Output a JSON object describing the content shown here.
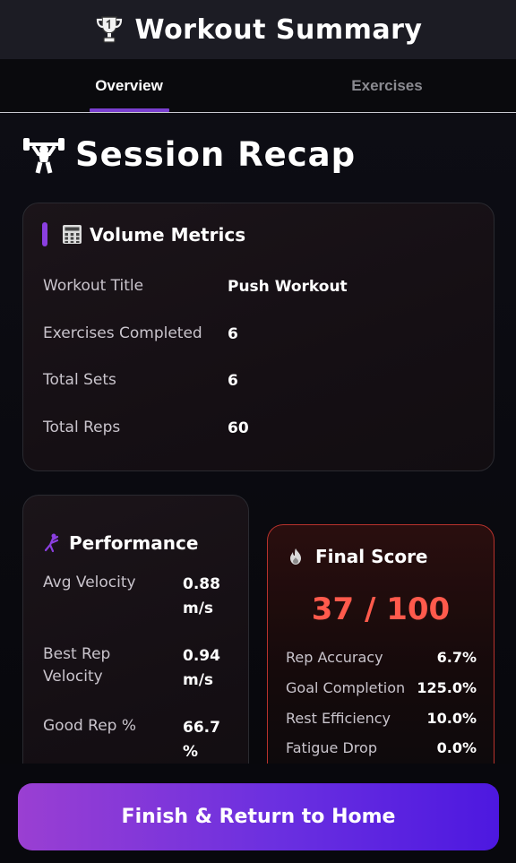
{
  "header": {
    "title": "Workout Summary",
    "icon": "trophy-icon"
  },
  "tabs": [
    {
      "label": "Overview",
      "active": true
    },
    {
      "label": "Exercises",
      "active": false
    }
  ],
  "section": {
    "title": "Session Recap",
    "icon": "weightlifter-icon"
  },
  "volume": {
    "title": "Volume Metrics",
    "icon": "calculator-icon",
    "rows": [
      {
        "label": "Workout Title",
        "value": "Push Workout"
      },
      {
        "label": "Exercises Completed",
        "value": "6"
      },
      {
        "label": "Total Sets",
        "value": "6"
      },
      {
        "label": "Total Reps",
        "value": "60"
      }
    ]
  },
  "performance": {
    "title": "Performance",
    "icon": "kick-icon",
    "rows": [
      {
        "label_line1": "Avg Velocity",
        "label_line2": "",
        "value_line1": "0.88",
        "value_line2": "m/s"
      },
      {
        "label_line1": "Best Rep",
        "label_line2": "Velocity",
        "value_line1": "0.94",
        "value_line2": "m/s"
      },
      {
        "label_line1": "Good Rep %",
        "label_line2": "",
        "value_line1": "66.7",
        "value_line2": "%"
      }
    ]
  },
  "score": {
    "title": "Final Score",
    "icon": "flame-icon",
    "value": "37 / 100",
    "rows": [
      {
        "label": "Rep Accuracy",
        "value": "6.7%"
      },
      {
        "label": "Goal Completion",
        "value": "125.0%"
      },
      {
        "label": "Rest Efficiency",
        "value": "10.0%"
      },
      {
        "label": "Fatigue Drop",
        "value": "0.0%"
      }
    ]
  },
  "finish_button": {
    "label": "Finish & Return to Home"
  },
  "colors": {
    "accent": "#7a3fd0",
    "score": "#ff5a4c",
    "score_border": "#b8322c"
  }
}
